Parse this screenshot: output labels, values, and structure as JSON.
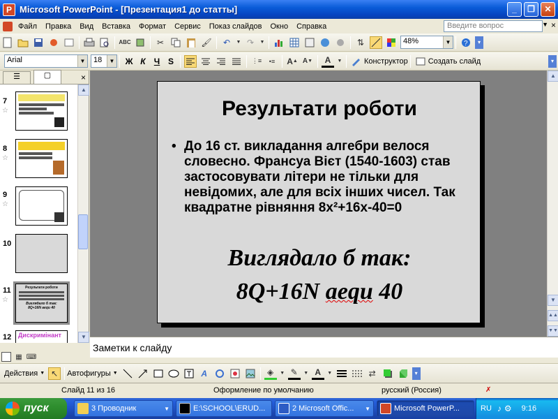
{
  "window": {
    "title": "Microsoft PowerPoint - [Презентация1 до статты]",
    "min_label": "_",
    "max_label": "❐",
    "close_label": "✕"
  },
  "menu": {
    "items": [
      "Файл",
      "Правка",
      "Вид",
      "Вставка",
      "Формат",
      "Сервис",
      "Показ слайдов",
      "Окно",
      "Справка"
    ],
    "ask_placeholder": "Введите вопрос",
    "close_doc": "×"
  },
  "standard_toolbar": {
    "zoom": "48%"
  },
  "format_toolbar": {
    "font": "Arial",
    "size": "18",
    "bold": "Ж",
    "italic": "К",
    "underline": "Ч",
    "shadow": "S",
    "design_label": "Конструктор",
    "new_slide_label": "Создать слайд"
  },
  "thumbnails": [
    {
      "num": "7"
    },
    {
      "num": "8"
    },
    {
      "num": "9"
    },
    {
      "num": "10"
    },
    {
      "num": "11"
    },
    {
      "num": "12"
    }
  ],
  "thumb_texts": {
    "t11_title": "Результати роботи",
    "t11_line1": "Виглядало б так:",
    "t11_line2": "8Q+16N aequ 40",
    "t12_title": "Дискримінант"
  },
  "slide": {
    "title": "Результати роботи",
    "bullet": "До 16 ст. викладання алгебри велося словесно. Франсуа Вієт (1540-1603) став застосовувати літери не тільки для невідомих, але для всіх інших чисел. Так квадратне рівняння 8x²+16x-40=0",
    "line1": "Виглядало б так:",
    "line2_a": "8Q+16N ",
    "line2_b": "aequ",
    "line2_c": " 40"
  },
  "notes": {
    "placeholder": "Заметки к слайду"
  },
  "draw_toolbar": {
    "actions_label": "Действия",
    "autoshapes_label": "Автофигуры"
  },
  "status": {
    "slide_pos": "Слайд 11 из 16",
    "design": "Оформление по умолчанию",
    "language": "русский (Россия)"
  },
  "taskbar": {
    "start_label": "пуск",
    "tasks": [
      "3 Проводник",
      "E:\\SCHOOL\\ERUD...",
      "2 Microsoft Offic...",
      "Microsoft PowerP..."
    ],
    "lang": "RU",
    "time": "9:16"
  }
}
